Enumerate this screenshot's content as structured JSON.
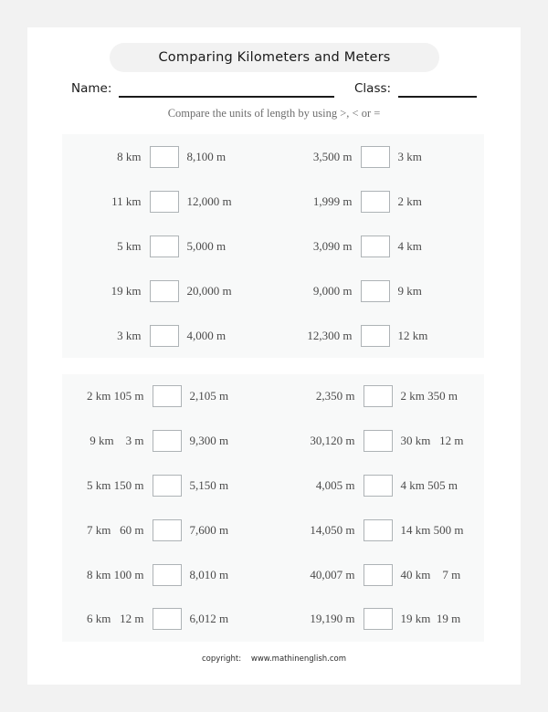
{
  "page": {
    "title": "Comparing Kilometers and Meters",
    "background_color": "#f2f2f2",
    "paper_color": "#ffffff",
    "panel_color": "#f8f9f9",
    "banner_color": "#f2f2f2",
    "text_color": "#4a4a4a"
  },
  "header": {
    "title": "Comparing Kilometers and Meters",
    "name_label": "Name:",
    "name_value": "",
    "class_label": "Class:",
    "class_value": "",
    "instruction": "Compare the units of length by using >, < or ="
  },
  "sections": [
    {
      "id": "section-1",
      "rows": [
        {
          "left": {
            "operand_left": "8 km",
            "answer": "",
            "operand_right": "8,100 m"
          },
          "right": {
            "operand_left": "3,500 m",
            "answer": "",
            "operand_right": "3 km"
          }
        },
        {
          "left": {
            "operand_left": "11 km",
            "answer": "",
            "operand_right": "12,000 m"
          },
          "right": {
            "operand_left": "1,999 m",
            "answer": "",
            "operand_right": "2 km"
          }
        },
        {
          "left": {
            "operand_left": "5 km",
            "answer": "",
            "operand_right": "5,000 m"
          },
          "right": {
            "operand_left": "3,090 m",
            "answer": "",
            "operand_right": "4 km"
          }
        },
        {
          "left": {
            "operand_left": "19 km",
            "answer": "",
            "operand_right": "20,000 m"
          },
          "right": {
            "operand_left": "9,000 m",
            "answer": "",
            "operand_right": "9 km"
          }
        },
        {
          "left": {
            "operand_left": "3 km",
            "answer": "",
            "operand_right": "4,000 m"
          },
          "right": {
            "operand_left": "12,300 m",
            "answer": "",
            "operand_right": "12 km"
          }
        }
      ]
    },
    {
      "id": "section-2",
      "rows": [
        {
          "left": {
            "operand_left": "2 km 105 m",
            "answer": "",
            "operand_right": "2,105 m"
          },
          "right": {
            "operand_left": "2,350 m",
            "answer": "",
            "operand_right": "2 km 350 m"
          }
        },
        {
          "left": {
            "operand_left": "9 km    3 m",
            "answer": "",
            "operand_right": "9,300 m"
          },
          "right": {
            "operand_left": "30,120 m",
            "answer": "",
            "operand_right": "30 km   12 m"
          }
        },
        {
          "left": {
            "operand_left": "5 km 150 m",
            "answer": "",
            "operand_right": "5,150 m"
          },
          "right": {
            "operand_left": "4,005 m",
            "answer": "",
            "operand_right": "4 km 505 m"
          }
        },
        {
          "left": {
            "operand_left": "7 km   60 m",
            "answer": "",
            "operand_right": "7,600 m"
          },
          "right": {
            "operand_left": "14,050 m",
            "answer": "",
            "operand_right": "14 km 500 m"
          }
        },
        {
          "left": {
            "operand_left": "8 km 100 m",
            "answer": "",
            "operand_right": "8,010 m"
          },
          "right": {
            "operand_left": "40,007 m",
            "answer": "",
            "operand_right": "40 km    7 m"
          }
        },
        {
          "left": {
            "operand_left": "6 km   12 m",
            "answer": "",
            "operand_right": "6,012 m"
          },
          "right": {
            "operand_left": "19,190 m",
            "answer": "",
            "operand_right": "19 km  19 m"
          }
        }
      ]
    }
  ],
  "footer": {
    "copyright": "copyright:    www.mathinenglish.com"
  }
}
